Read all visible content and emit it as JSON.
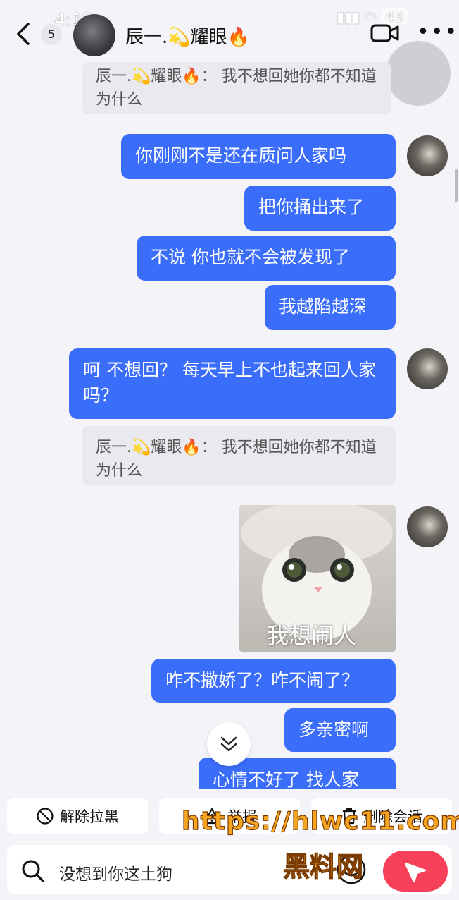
{
  "status_bar": {
    "time": "4:18",
    "battery": "43"
  },
  "header": {
    "unread_count": "5",
    "contact_name": "辰一.💫耀眼🔥"
  },
  "messages": {
    "quote1": "辰一.💫耀眼🔥：  我不想回她你都不知道为什么",
    "bubble1": "你刚刚不是还在质问人家吗",
    "bubble2": "把你捅出来了",
    "bubble3": "不说 你也就不会被发现了",
    "bubble4": "我越陷越深",
    "bubble5": "呵 不想回？ 每天早上不也起来回人家吗？",
    "quote2": "辰一.💫耀眼🔥：  我不想回她你都不知道为什么",
    "sticker_caption": "我想闹人",
    "bubble6": "咋不撒娇了？咋不闹了？",
    "bubble7": "多亲密啊",
    "bubble8": "心情不好了 找人家"
  },
  "actions": {
    "unblock": "解除拉黑",
    "report": "举报",
    "delete": "删除会话"
  },
  "input": {
    "text": "没想到你这土狗"
  },
  "watermark": {
    "line1": "https://hlwc11.com",
    "line2": "黑料网"
  },
  "colors": {
    "bubble": "#3b6dfb",
    "send": "#f7405a",
    "background": "#f3f3f8"
  }
}
